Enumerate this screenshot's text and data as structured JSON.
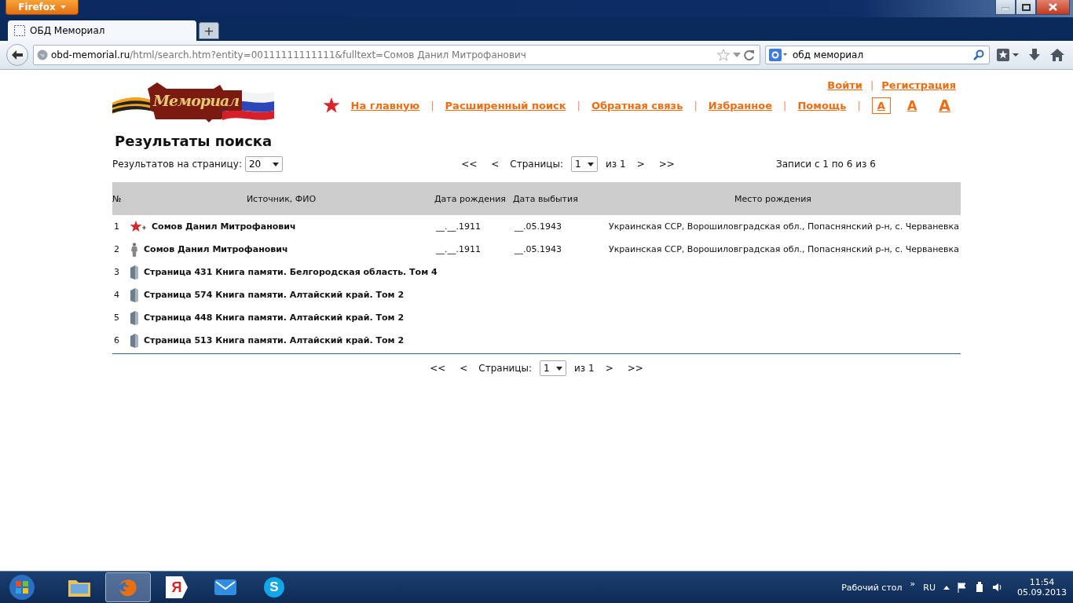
{
  "browser": {
    "menu_button": "Firefox",
    "tabs": [
      {
        "title": "ОБД Мемориал",
        "selected": true
      }
    ],
    "new_tab": "+",
    "url_domain": "obd-memorial.ru",
    "url_path": "/html/search.htm?entity=00111111111111&fulltext=Сомов Данил Митрофанович",
    "search_value": "обд мемориал"
  },
  "logo": {
    "text": "Мемориал"
  },
  "account_links": [
    {
      "kind": "link",
      "label": "Войти"
    },
    {
      "kind": "separator",
      "label": "|"
    },
    {
      "kind": "link",
      "label": "Регистрация"
    }
  ],
  "nav_links": [
    {
      "kind": "link",
      "label": "На главную"
    },
    {
      "kind": "separator",
      "label": "|"
    },
    {
      "kind": "link",
      "label": "Расширенный поиск"
    },
    {
      "kind": "separator",
      "label": "|"
    },
    {
      "kind": "link",
      "label": "Обратная связь"
    },
    {
      "kind": "separator",
      "label": "|"
    },
    {
      "kind": "link",
      "label": "Избранное"
    },
    {
      "kind": "separator",
      "label": "|"
    },
    {
      "kind": "link",
      "label": "Помощь"
    },
    {
      "kind": "separator",
      "label": "|"
    }
  ],
  "font_sizes": [
    {
      "label": "A",
      "selected": true
    },
    {
      "label": "A",
      "selected": false
    },
    {
      "label": "A",
      "selected": false
    }
  ],
  "title": "Результаты поиска",
  "per_page": {
    "label": "Результатов на страницу:",
    "value": "20"
  },
  "pager_top": {
    "first": "<<",
    "prev": "<",
    "label": "Страницы:",
    "value": "1",
    "of": "из 1",
    "next": ">",
    "last": ">>"
  },
  "records": "Записи с 1 по 6 из 6",
  "table": {
    "columns": [
      "№",
      "Источник, ФИО",
      "Дата рождения",
      "Дата выбытия",
      "Место рождения"
    ],
    "rows": [
      {
        "kind": "killed",
        "num": "1",
        "name": "Сомов Данил Митрофанович",
        "birth": "__.__.1911",
        "death": "__.05.1943",
        "place": "Украинская ССР, Ворошиловградская обл., Попаснянский р-н, с. Черваневка"
      },
      {
        "kind": "person",
        "num": "2",
        "name": "Сомов Данил Митрофанович",
        "birth": "__.__.1911",
        "death": "__.05.1943",
        "place": "Украинская ССР, Ворошиловградская обл., Попаснянский р-н, с. Черваневка"
      },
      {
        "kind": "book",
        "num": "3",
        "name": "Страница 431 Книга памяти. Белгородская область. Том 4"
      },
      {
        "kind": "book",
        "num": "4",
        "name": "Страница 574 Книга памяти. Алтайский край. Том 2"
      },
      {
        "kind": "book",
        "num": "5",
        "name": "Страница 448 Книга памяти. Алтайский край. Том 2"
      },
      {
        "kind": "book",
        "num": "6",
        "name": "Страница 513 Книга памяти. Алтайский край. Том 2"
      }
    ]
  },
  "pager_bottom": {
    "first": "<<",
    "prev": "<",
    "label": "Страницы:",
    "value": "1",
    "of": "из 1",
    "next": ">",
    "last": ">>"
  },
  "taskbar": {
    "apps": [
      {
        "kind": "folder",
        "selected": false
      },
      {
        "kind": "firefox",
        "selected": true
      },
      {
        "kind": "yandex",
        "glyph": "Я",
        "selected": false
      },
      {
        "kind": "mail",
        "selected": false
      },
      {
        "kind": "skype",
        "glyph": "S",
        "selected": false
      }
    ],
    "desktop": "Рабочий стол",
    "chevron": "»",
    "lang": "RU",
    "time": "11:54",
    "date": "05.09.2013"
  }
}
